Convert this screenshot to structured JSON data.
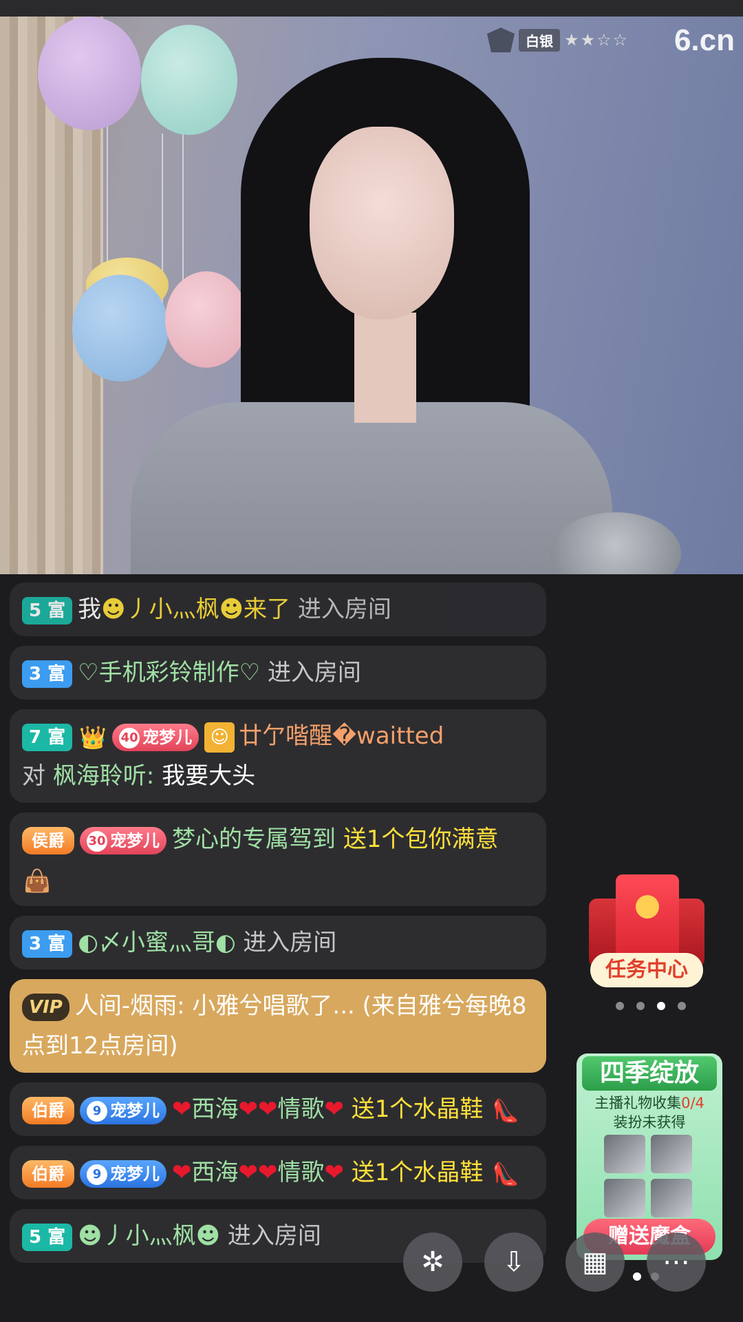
{
  "stream": {
    "rank_label": "白银",
    "stars": "★★☆☆",
    "logo": "6.cn"
  },
  "chat": [
    {
      "rich": "5 富",
      "prefix": "我",
      "name": "☻丿小灬枫☻来了",
      "action": "进入房间"
    },
    {
      "rich": "3 富",
      "name": "♡手机彩铃制作♡",
      "action": "进入房间"
    },
    {
      "rich": "7 富",
      "crown": "👑",
      "fan_level": "40",
      "fan_name": "宠梦儿",
      "name": "廿亇喈醒�waitted",
      "to": "对",
      "target": "枫海聆听:",
      "text": "我要大头"
    },
    {
      "noble": "侯爵",
      "fan_level": "30",
      "fan_name": "宠梦儿",
      "name": "梦心的专属驾到",
      "gift_text": "送1个包你满意",
      "gift_icon": "👜"
    },
    {
      "rich": "3 富",
      "name": "◐〆小蜜灬哥◐",
      "action": "进入房间"
    },
    {
      "vip": "VIP",
      "text": "人间-烟雨: 小雅兮唱歌了... (来自雅兮每晚8点到12点房间)"
    },
    {
      "noble": "伯爵",
      "fan_level": "9",
      "fan_name": "宠梦儿",
      "name_parts": [
        "❤",
        "西海",
        "❤❤",
        "情歌",
        "❤"
      ],
      "gift_text": "送1个水晶鞋",
      "gift_icon": "👠"
    },
    {
      "noble": "伯爵",
      "fan_level": "9",
      "fan_name": "宠梦儿",
      "name_parts": [
        "❤",
        "西海",
        "❤❤",
        "情歌",
        "❤"
      ],
      "gift_text": "送1个水晶鞋",
      "gift_icon": "👠"
    },
    {
      "rich": "5 富",
      "name": "☻丿小灬枫☻",
      "action": "进入房间"
    }
  ],
  "task_center": {
    "label": "任务中心"
  },
  "season": {
    "title": "四季绽放",
    "sub1": "主播礼物收集",
    "count": "0/4",
    "sub2": "装扮未获得",
    "button": "赠送魔盒"
  }
}
